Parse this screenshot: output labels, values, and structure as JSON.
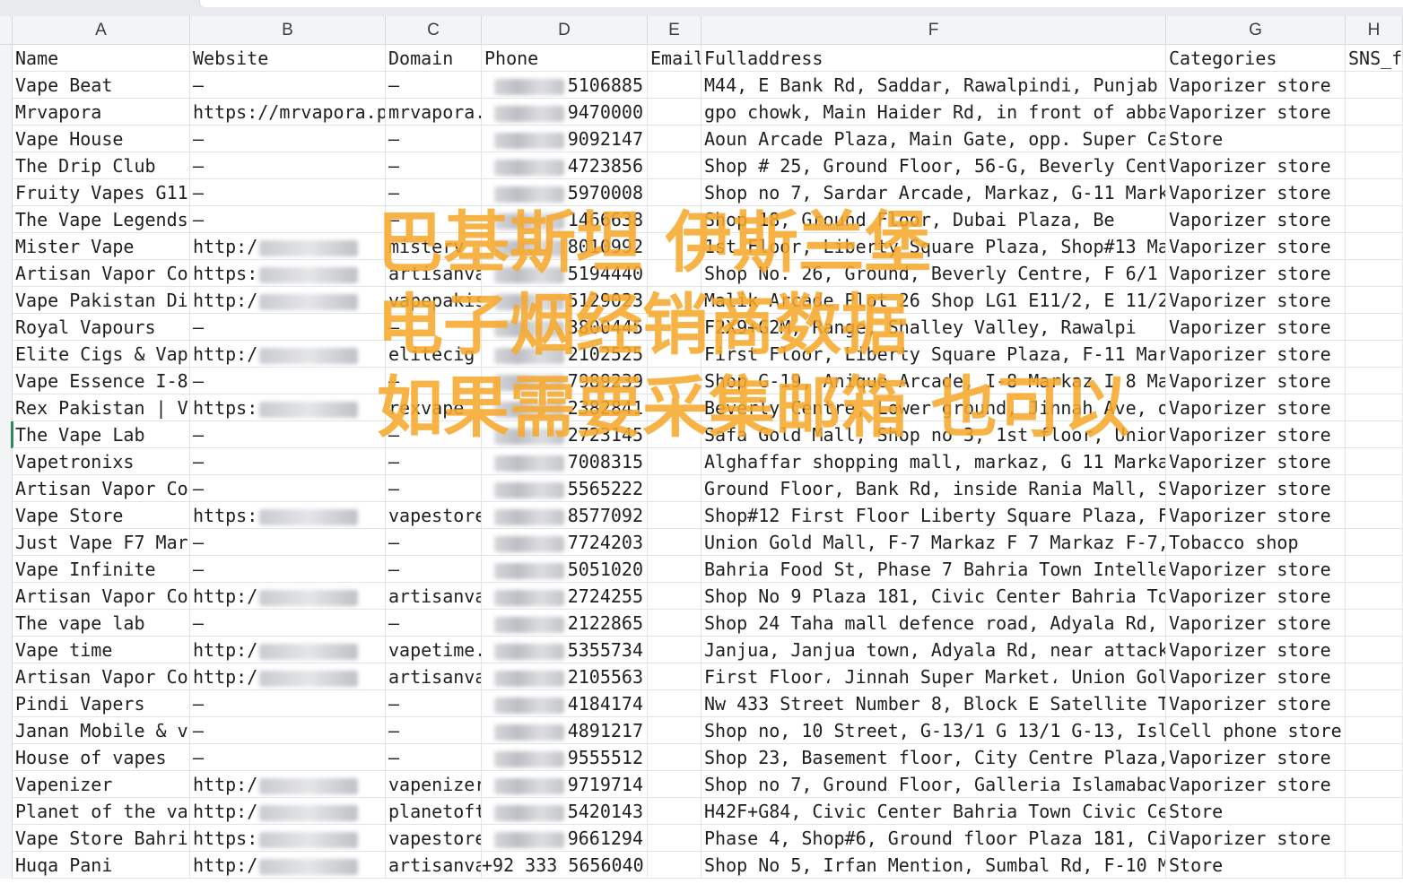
{
  "columns": [
    "A",
    "B",
    "C",
    "D",
    "E",
    "F",
    "G",
    "H"
  ],
  "header_row": [
    "Name",
    "Website",
    "Domain",
    "Phone",
    "Email",
    "Fulladdress",
    "Categories",
    "SNS_f"
  ],
  "rows": [
    {
      "name": "Vape Beat",
      "website": "–",
      "domain": "–",
      "phone": "5106885",
      "full": "M44, E Bank Rd, Saddar, Rawalpindi, Punjab",
      "cat": "Vaporizer store"
    },
    {
      "name": "Mrvapora",
      "website": "https://mrvapora.p",
      "domain": "mrvapora.",
      "phone": "9470000",
      "full": "gpo chowk, Main Haider Rd, in front of abba",
      "cat": "Vaporizer store"
    },
    {
      "name": "Vape House",
      "website": "–",
      "domain": "–",
      "phone": "9092147",
      "full": "Aoun Arcade Plaza, Main Gate, opp. Super Ca",
      "cat": "Store"
    },
    {
      "name": "The Drip Club",
      "website": "–",
      "domain": "–",
      "phone": "4723856",
      "full": "Shop # 25, Ground Floor, 56-G, Beverly Cent",
      "cat": "Vaporizer store"
    },
    {
      "name": "Fruity Vapes G11",
      "website": "–",
      "domain": "–",
      "phone": "5970008",
      "full": "Shop no 7, Sardar Arcade, Markaz, G-11 Mark",
      "cat": "Vaporizer store"
    },
    {
      "name": "The Vape Legends",
      "website": "–",
      "domain": "–",
      "phone": "1466638",
      "full": "Shop 18, Ground Floor, Dubai Plaza, Be",
      "cat": "Vaporizer store"
    },
    {
      "name": "Mister Vape",
      "website": "http:/",
      "domain": "misterv",
      "phone": "8010992",
      "full": "1st Floor, Liberty Square Plaza, Shop#13 Ma",
      "cat": "Vaporizer store"
    },
    {
      "name": "Artisan Vapor Co",
      "website": "https:",
      "domain": "artisanva",
      "phone": "5194440",
      "full": "Shop No. 26, Ground, Beverly Centre, F 6/1",
      "cat": "Vaporizer store"
    },
    {
      "name": "Vape Pakistan Di",
      "website": "http:/",
      "domain": "vapepakis",
      "phone": "5129023",
      "full": "Malik Arcade Plot 26 Shop LG1 E11/2, E 11/2",
      "cat": "Vaporizer store"
    },
    {
      "name": "Royal Vapours",
      "website": "–",
      "domain": "–",
      "phone": "3800445",
      "full": "F2X9+G2M, Range, Shalley Valley, Rawalpi",
      "cat": "Vaporizer store"
    },
    {
      "name": "Elite Cigs & Vap",
      "website": "http:/",
      "domain": "elitecig",
      "phone": "2102525",
      "full": "First Floor, Liberty Square Plaza, F-11 Mar",
      "cat": "Vaporizer store"
    },
    {
      "name": "Vape Essence I-8",
      "website": "–",
      "domain": "–",
      "phone": "7989239",
      "full": "Shop G-19, Anique Arcade, I-8 Markaz I 8 Ma",
      "cat": "Vaporizer store"
    },
    {
      "name": "Rex Pakistan | V",
      "website": "https:",
      "domain": "rexvape",
      "phone": "2382841",
      "full": "Beverly Centre, Lower ground, Jinnah Ave, o",
      "cat": "Vaporizer store"
    },
    {
      "name": "The Vape Lab",
      "website": "–",
      "domain": "–",
      "phone": "2723145",
      "full": "Safa Gold Mall, Shop no 3, 1st floor, Union",
      "cat": "Vaporizer store"
    },
    {
      "name": "Vapetronixs",
      "website": "–",
      "domain": "–",
      "phone": "7008315",
      "full": "Alghaffar shopping mall, markaz, G 11 Marka",
      "cat": "Vaporizer store"
    },
    {
      "name": "Artisan Vapor Co",
      "website": "–",
      "domain": "–",
      "phone": "5565222",
      "full": "Ground Floor, Bank Rd, inside Rania Mall, S",
      "cat": "Vaporizer store"
    },
    {
      "name": "Vape Store",
      "website": "https:",
      "domain": "vapestore",
      "phone": "8577092",
      "full": "Shop#12 First Floor Liberty Square Plaza, F",
      "cat": "Vaporizer store"
    },
    {
      "name": "Just Vape F7 Mar",
      "website": "–",
      "domain": "–",
      "phone": "7724203",
      "full": "Union Gold Mall, F-7 Markaz F 7 Markaz F-7,",
      "cat": "Tobacco shop"
    },
    {
      "name": "Vape Infinite",
      "website": "–",
      "domain": "–",
      "phone": "5051020",
      "full": "Bahria Food St, Phase 7 Bahria Town Intelle",
      "cat": "Vaporizer store"
    },
    {
      "name": "Artisan Vapor Co",
      "website": "http:/",
      "domain": "artisanva",
      "phone": "2724255",
      "full": "Shop No 9 Plaza 181, Civic Center Bahria To",
      "cat": "Vaporizer store"
    },
    {
      "name": "The vape lab",
      "website": "–",
      "domain": "–",
      "phone": "2122865",
      "full": "Shop 24 Taha mall defence road, Adyala Rd,",
      "cat": "Vaporizer store"
    },
    {
      "name": "Vape time",
      "website": "http:/",
      "domain": "vapetime.",
      "phone": "5355734",
      "full": "Janjua, Janjua town, Adyala Rd, near attack",
      "cat": "Vaporizer store"
    },
    {
      "name": "Artisan Vapor Co",
      "website": "http:/",
      "domain": "artisanva",
      "phone": "2105563",
      "full": "First Floor، Jinnah Super Market، Union Gold",
      "cat": "Vaporizer store"
    },
    {
      "name": "Pindi Vapers",
      "website": "–",
      "domain": "–",
      "phone": "4184174",
      "full": "Nw 433 Street Number 8, Block E Satellite T",
      "cat": "Vaporizer store"
    },
    {
      "name": "Janan Mobile & v",
      "website": "–",
      "domain": "–",
      "phone": "4891217",
      "full": "Shop no, 10 Street, G-13/1 G 13/1 G-13, Isl",
      "cat": "Cell phone store"
    },
    {
      "name": "House of vapes",
      "website": "–",
      "domain": "–",
      "phone": "9555512",
      "full": "Shop 23, Basement floor, City Centre Plaza,",
      "cat": "Vaporizer store"
    },
    {
      "name": "Vapenizer",
      "website": "http:/",
      "domain": "vapenizer",
      "phone": "9719714",
      "full": "Shop no 7, Ground Floor, Galleria Islamabad",
      "cat": "Vaporizer store"
    },
    {
      "name": "Planet of the va",
      "website": "http:/",
      "domain": "planetoft",
      "phone": "5420143",
      "full": "H42F+G84, Civic Center Bahria Town Civic Ce",
      "cat": "Store"
    },
    {
      "name": "Vape Store Bahri",
      "website": "https:",
      "domain": "vapestore",
      "phone": "9661294",
      "full": "Phase 4, Shop#6, Ground floor Plaza 181, Ci",
      "cat": "Vaporizer store"
    },
    {
      "name": "Huqa Pani",
      "website": "http:/",
      "domain": "artisanva",
      "phone": "+92 333 5656040",
      "full": "Shop No 5, Irfan Mention, Sumbal Rd, F-10 M",
      "cat": "Store"
    }
  ],
  "overlay": {
    "line1": "巴基斯坦 伊斯兰堡",
    "line2": "电子烟经销商数据",
    "line3": "如果需要采集邮箱 也可以"
  }
}
